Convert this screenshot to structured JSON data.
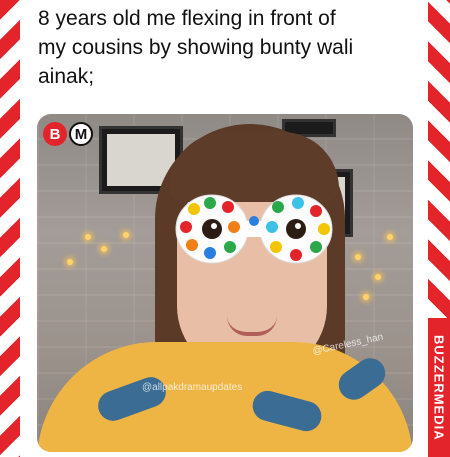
{
  "caption": {
    "line1": "8 years old me flexing in front of",
    "line2": "my cousins by showing bunty wali",
    "line3": "ainak;"
  },
  "logo": {
    "left_letter": "B",
    "right_letter": "M"
  },
  "watermarks": {
    "credit": "@Careless_han",
    "page": "@allpakdramaupdates"
  },
  "sidebar_brand": "BUZZERMEDIA",
  "colors": {
    "accent_red": "#e4242b",
    "shirt_yellow": "#eeb545"
  }
}
